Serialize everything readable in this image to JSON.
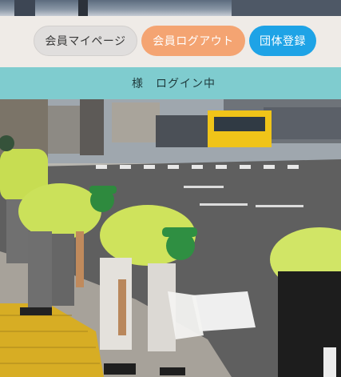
{
  "header": {
    "buttons": {
      "mypage": "会員マイページ",
      "logout": "会員ログアウト",
      "register": "団体登録"
    }
  },
  "status": {
    "login_text": "様　ログイン中"
  },
  "photo": {
    "semantic": "volunteers-cleaning-street-photo"
  },
  "colors": {
    "header_bg": "#efebe7",
    "logout_btn": "#f4a472",
    "register_btn": "#1ea3e6",
    "status_bar": "#7fcccf"
  }
}
